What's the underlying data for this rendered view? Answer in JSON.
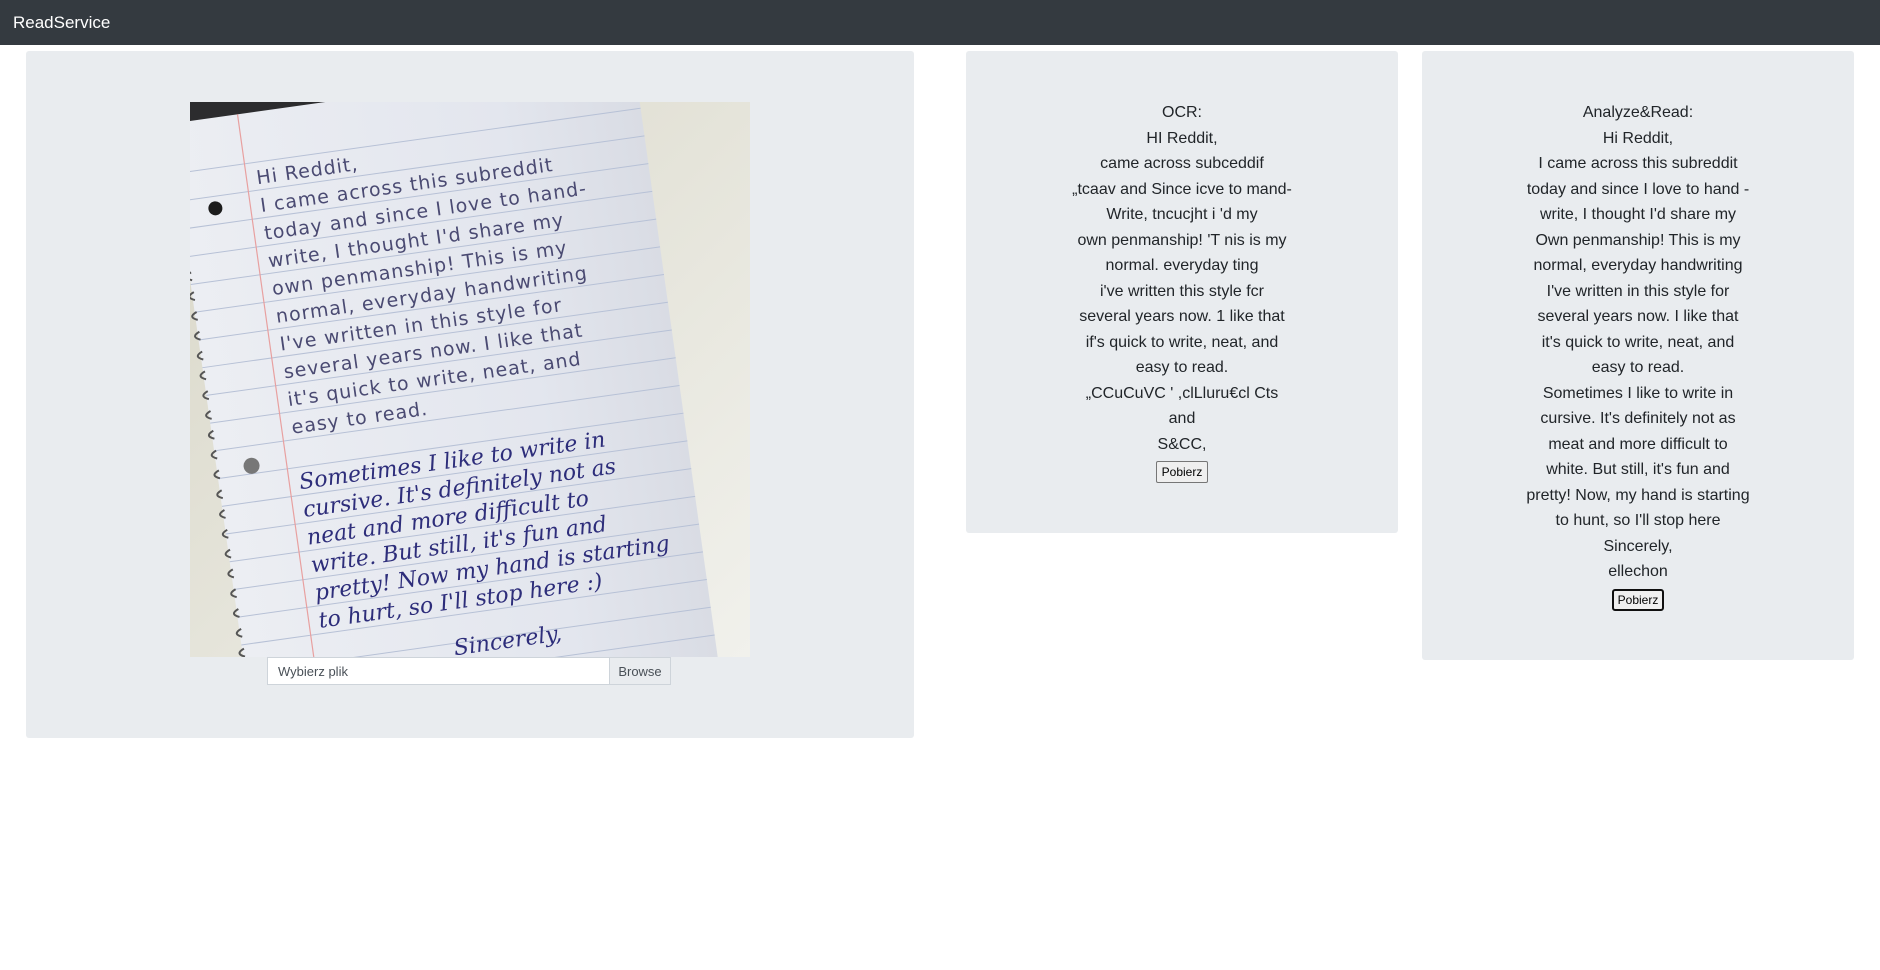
{
  "navbar": {
    "brand": "ReadService"
  },
  "upload": {
    "file_label": "Wybierz plik",
    "browse_label": "Browse",
    "image": {
      "description_lines": [
        "Hi Reddit,",
        "I came across this subreddit",
        "today and since I love to hand-",
        "write, I thought I'd share my",
        "own penmanship! This is my",
        "normal, everyday handwriting",
        "I've written in this style for",
        "several years now. I like that",
        "it's quick to write, neat, and",
        "easy to read."
      ],
      "cursive_lines": [
        "Sometimes I like to write in",
        "cursive. It's definitely not as",
        "neat and more difficult to",
        "write. But still, it's fun and",
        "pretty! Now my hand is starting",
        "to hurt, so I'll stop here :)",
        "Sincerely,",
        "ellechon"
      ]
    }
  },
  "ocr": {
    "heading": "OCR:",
    "lines": [
      "HI Reddit,",
      "came across subceddif",
      "„tcaav and Since icve to mand-",
      "Write, tncucjht i 'd my",
      "own penmanship! 'T nis is my",
      "normal. everyday ting",
      "i've written this style fcr",
      "several years now. 1 like that",
      "if's quick to write, neat, and",
      "easy to read.",
      "„CCuCuVC ' ,clLluru€cl Cts",
      "and",
      "S&CC,"
    ],
    "button_label": "Pobierz"
  },
  "analyze": {
    "heading": "Analyze&Read:",
    "lines": [
      "Hi Reddit,",
      "I came across this subreddit",
      "today and since I love to hand -",
      "write, I thought I'd share my",
      "Own penmanship! This is my",
      "normal, everyday handwriting",
      "I've written in this style for",
      "several years now. I like that",
      "it's quick to write, neat, and",
      "easy to read.",
      "Sometimes I like to write in",
      "cursive. It's definitely not as",
      "meat and more difficult to",
      "white. But still, it's fun and",
      "pretty! Now, my hand is starting",
      "to hunt, so I'll stop here",
      "Sincerely,",
      "ellechon"
    ],
    "button_label": "Pobierz"
  }
}
